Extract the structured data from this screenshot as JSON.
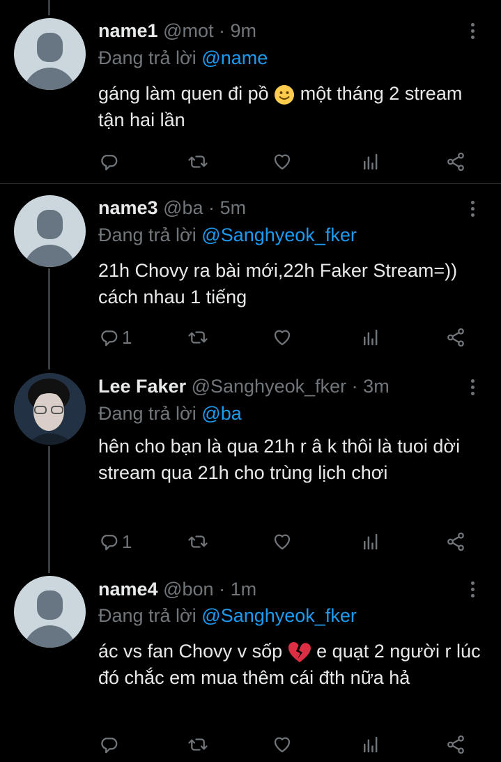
{
  "reply_prefix": "Đang trả lời",
  "tweets": [
    {
      "name": "name1",
      "handle": "@mot",
      "dot": "·",
      "time": "9m",
      "reply_to": "@name",
      "text_before": "gáng làm quen đi pồ",
      "emoji": "slightly-smiling-face",
      "text_after": "một tháng 2 stream tận hai lần",
      "reply_count": ""
    },
    {
      "name": "name3",
      "handle": "@ba",
      "dot": "·",
      "time": "5m",
      "reply_to": "@Sanghyeok_fker",
      "text": "21h Chovy ra bài mới,22h Faker Stream=)) cách nhau 1 tiếng",
      "reply_count": "1"
    },
    {
      "name": "Lee Faker",
      "handle": "@Sanghyeok_fker",
      "dot": "·",
      "time": "3m",
      "reply_to": "@ba",
      "text": "hên cho bạn là qua 21h r â k thôi là tuoi dời stream qua 21h cho trùng lịch chơi",
      "reply_count": "1"
    },
    {
      "name": "name4",
      "handle": "@bon",
      "dot": "·",
      "time": "1m",
      "reply_to": "@Sanghyeok_fker",
      "text_before": "ác vs fan Chovy v sốp",
      "emoji": "broken-heart",
      "text_after": "e quạt 2 người r lúc đó chắc em mua thêm cái đth nữa hả",
      "reply_count": ""
    }
  ],
  "icons": {
    "reply": "reply-icon",
    "retweet": "retweet-icon",
    "like": "heart-icon",
    "views": "analytics-icon",
    "share": "share-icon",
    "more": "more-vertical-icon"
  },
  "colors": {
    "background": "#000000",
    "text": "#e7e9ea",
    "secondary": "#71767b",
    "mention": "#1d9bf0",
    "divider": "#2f3336"
  }
}
